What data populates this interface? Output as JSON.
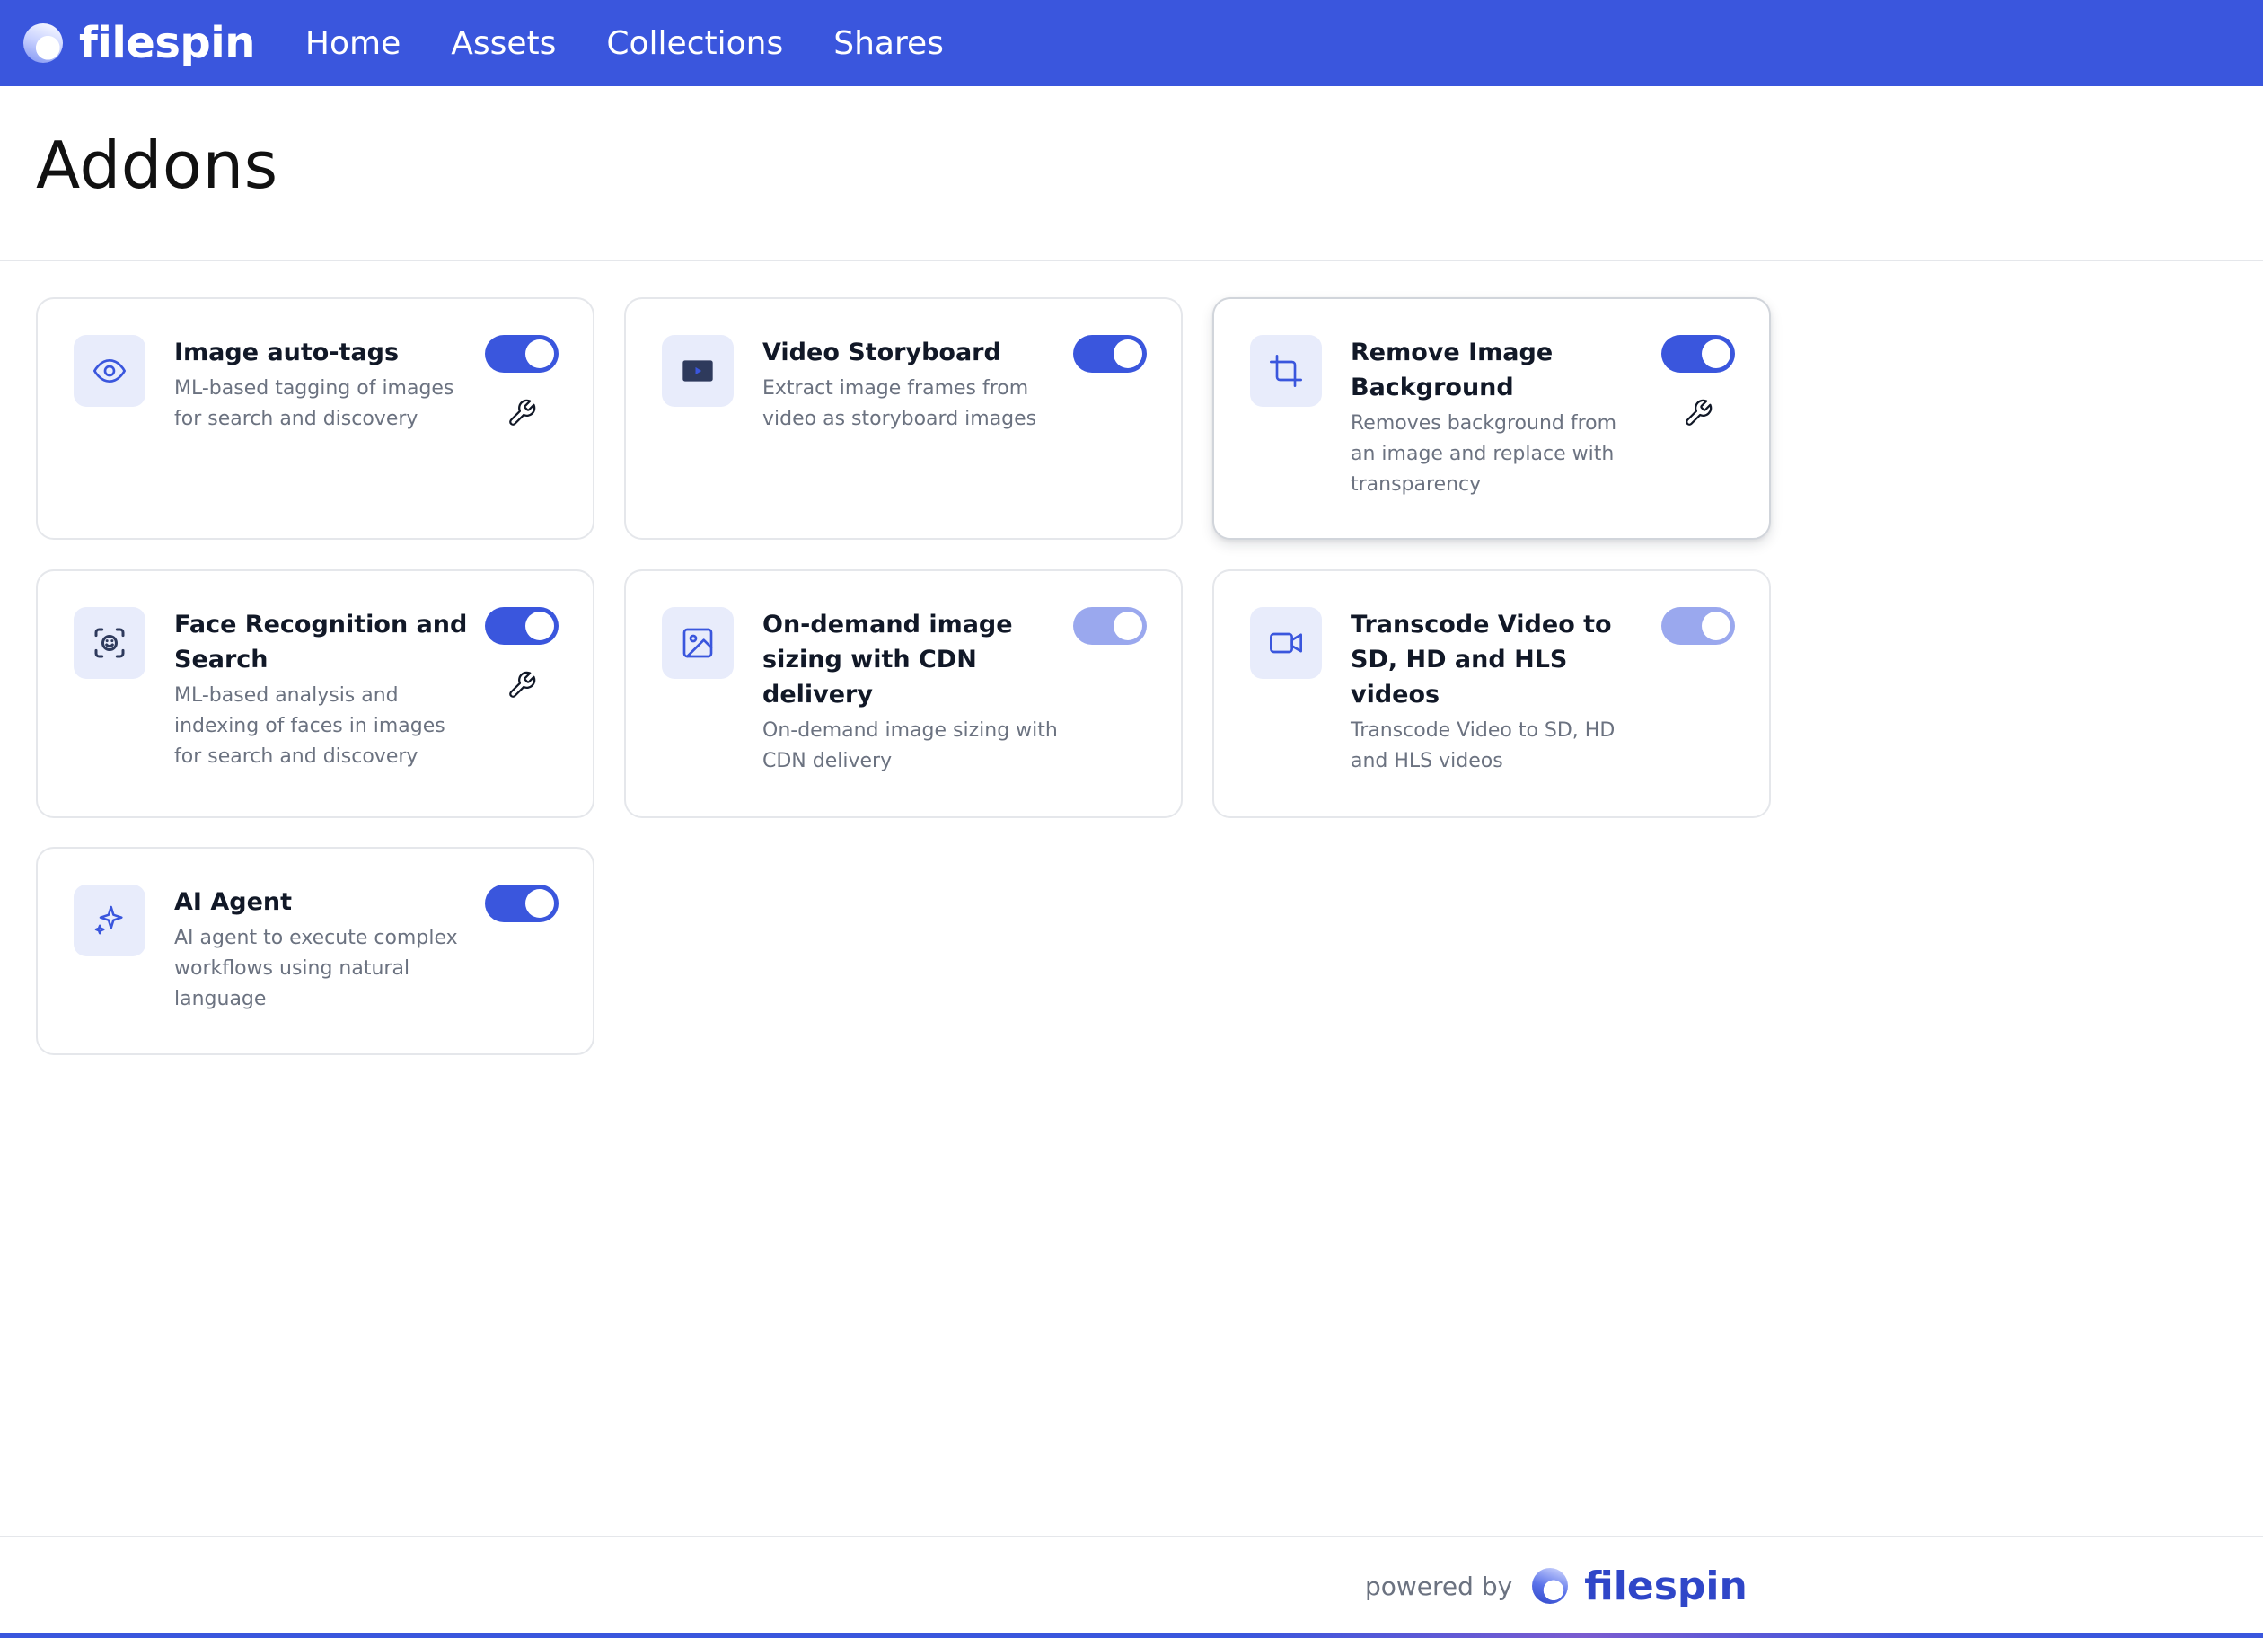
{
  "nav": {
    "brand": "filespin",
    "links": [
      "Home",
      "Assets",
      "Collections",
      "Shares"
    ],
    "background": "#3a56dd"
  },
  "page": {
    "title": "Addons"
  },
  "addons": [
    {
      "name": "Image auto-tags",
      "description": "ML-based tagging of images for search and discovery",
      "icon": "eye-icon",
      "enabled": true,
      "configurable": true
    },
    {
      "name": "Video Storyboard",
      "description": "Extract image frames from video as storyboard images",
      "icon": "storyboard-icon",
      "enabled": true,
      "configurable": false
    },
    {
      "name": "Remove Image Background",
      "description": "Removes background from an image and replace with transparency",
      "icon": "crop-icon",
      "enabled": true,
      "configurable": true
    },
    {
      "name": "Face Recognition and Search",
      "description": "ML-based analysis and indexing of faces in images for search and discovery",
      "icon": "face-scan-icon",
      "enabled": true,
      "configurable": true
    },
    {
      "name": "On-demand image sizing with CDN delivery",
      "description": "On-demand image sizing with CDN delivery",
      "icon": "image-icon",
      "enabled": true,
      "configurable": false
    },
    {
      "name": "Transcode Video to SD, HD and HLS videos",
      "description": "Transcode Video to SD, HD and HLS videos",
      "icon": "video-camera-icon",
      "enabled": true,
      "configurable": false
    },
    {
      "name": "AI Agent",
      "description": "AI agent to execute complex workflows using natural language",
      "icon": "sparkle-icon",
      "enabled": true,
      "configurable": false
    }
  ],
  "footer": {
    "powered_by": "powered by",
    "brand": "filespin"
  },
  "colors": {
    "accent": "#3a56dd",
    "toggle_light": "#9aa8ee",
    "icon_tile": "#e8ecfb"
  }
}
